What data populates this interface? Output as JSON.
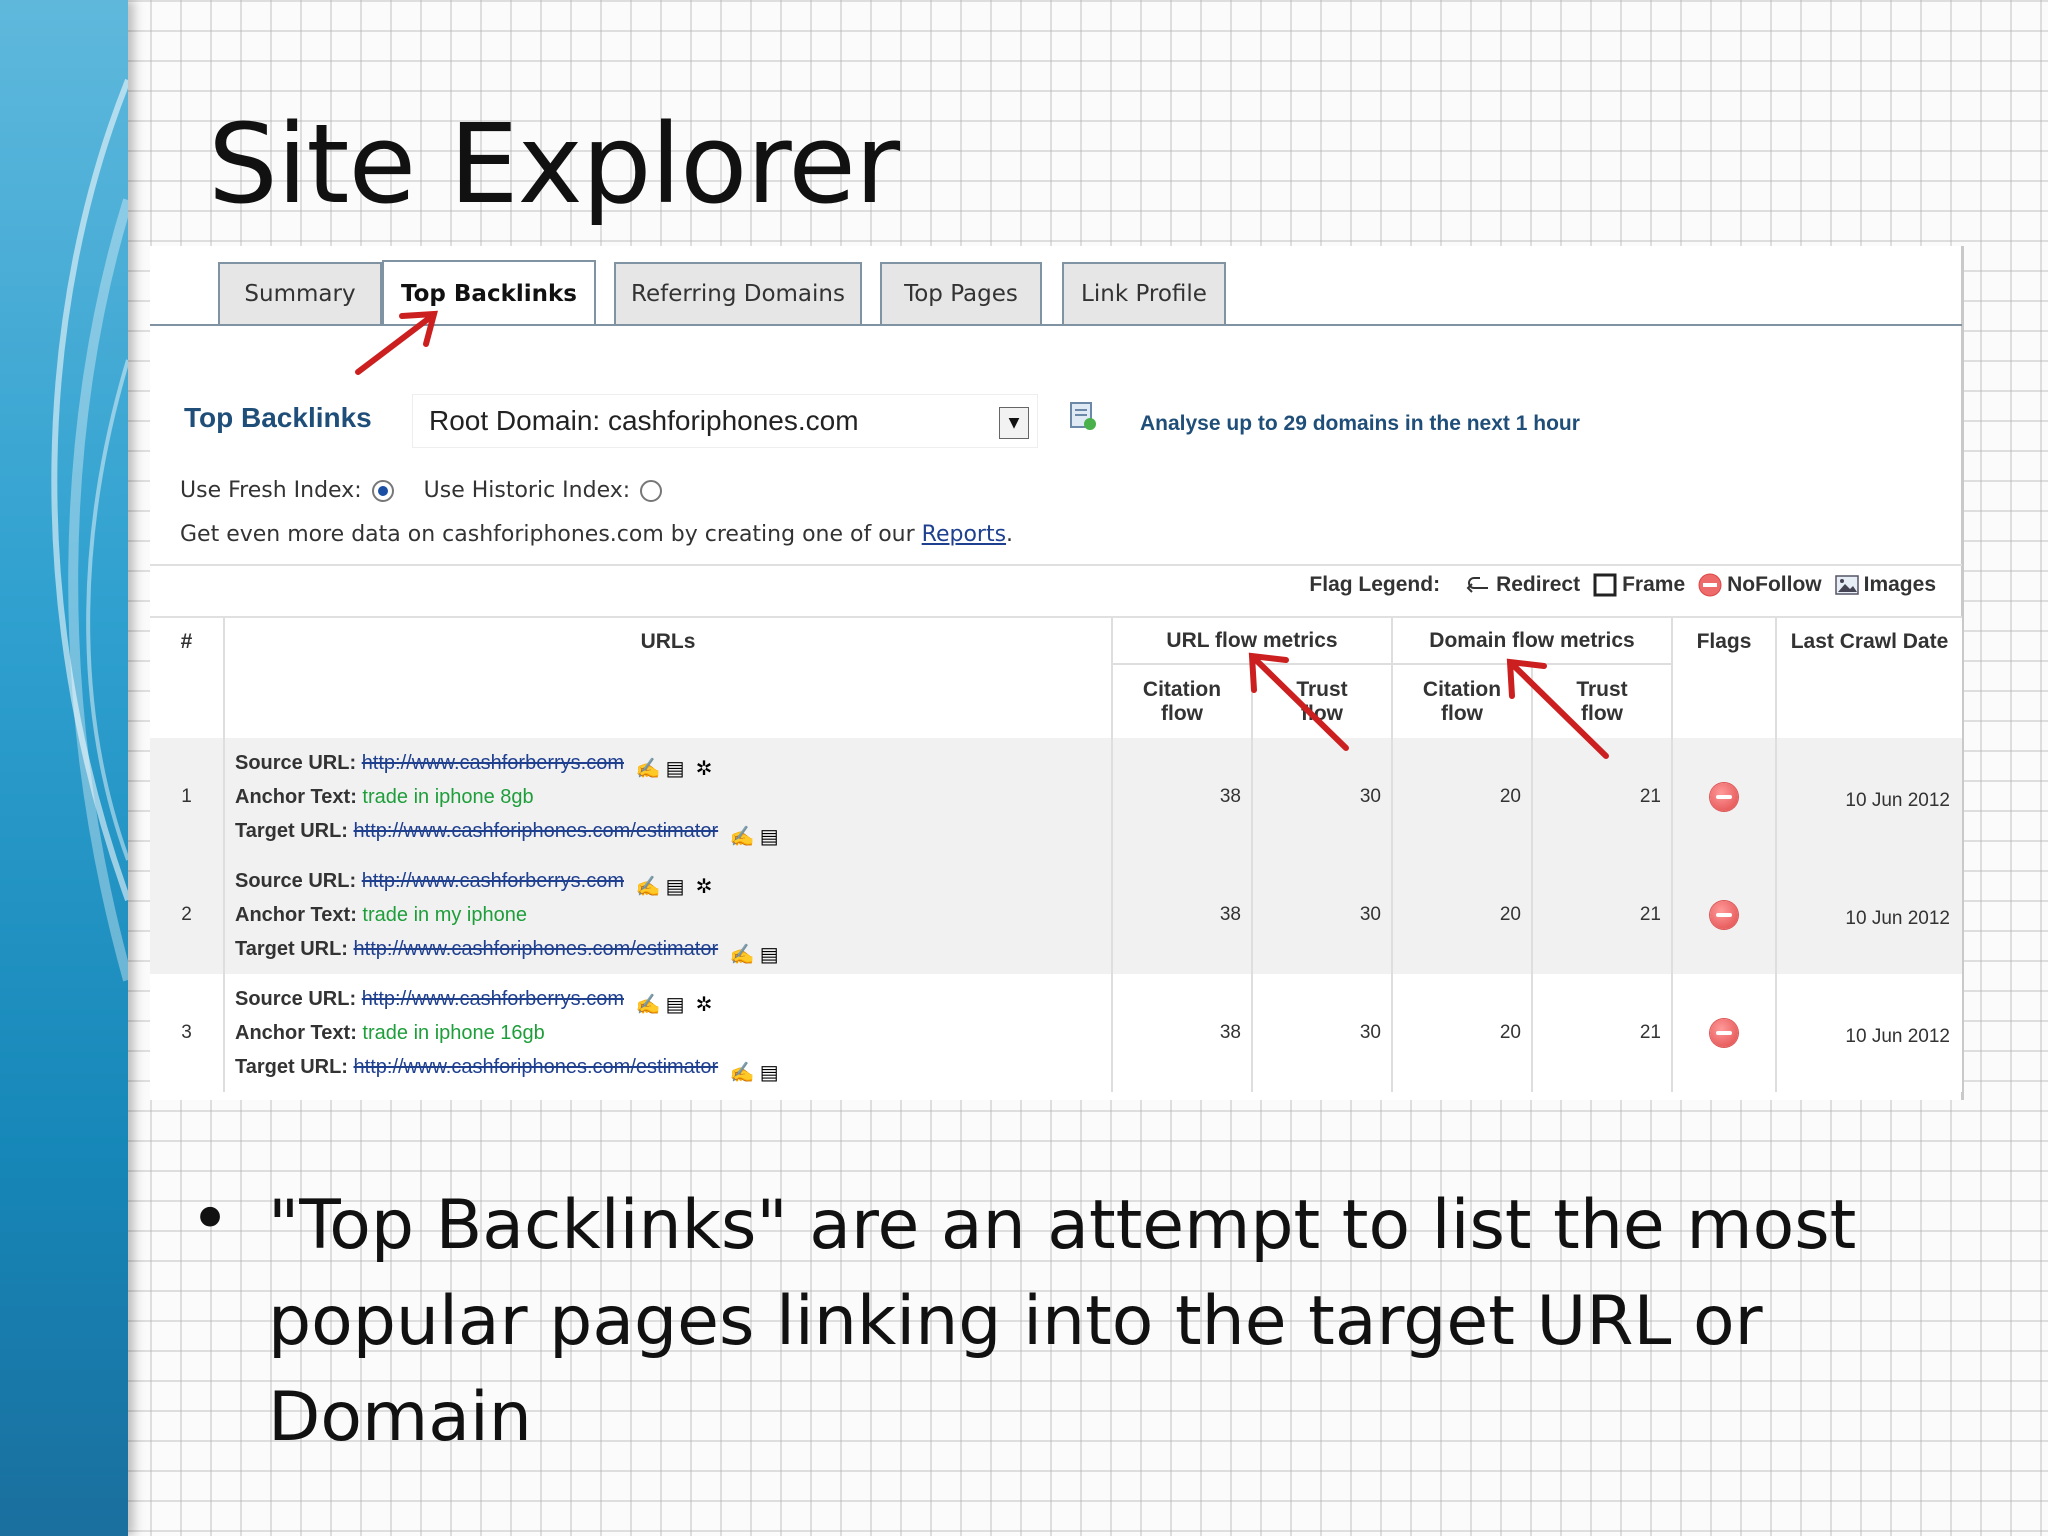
{
  "slide": {
    "title": "Site Explorer",
    "bullet": "\"Top Backlinks\" are an attempt to list the most popular pages linking into the target URL or Domain"
  },
  "tabs": [
    {
      "label": "Summary",
      "active": false
    },
    {
      "label": "Top Backlinks",
      "active": true
    },
    {
      "label": "Referring Domains",
      "active": false
    },
    {
      "label": "Top Pages",
      "active": false
    },
    {
      "label": "Link Profile",
      "active": false
    }
  ],
  "controls": {
    "section_label": "Top Backlinks",
    "domain_select": "Root Domain: cashforiphones.com",
    "analyse_text": "Analyse up to 29 domains in the next 1 hour",
    "fresh_index_label": "Use Fresh Index:",
    "fresh_index_selected": true,
    "historic_index_label": "Use Historic Index:",
    "historic_index_selected": false,
    "more_data_text": "Get even more data on cashforiphones.com by creating one of our",
    "reports_link": "Reports",
    "more_data_end": "."
  },
  "legend": {
    "title": "Flag Legend:",
    "items": [
      {
        "icon": "redirect-icon",
        "label": "Redirect"
      },
      {
        "icon": "frame-icon",
        "label": "Frame"
      },
      {
        "icon": "nofollow-icon",
        "label": "NoFollow"
      },
      {
        "icon": "images-icon",
        "label": "Images"
      }
    ]
  },
  "table": {
    "headers": {
      "num": "#",
      "urls": "URLs",
      "url_flow": "URL flow metrics",
      "domain_flow": "Domain flow metrics",
      "flags": "Flags",
      "last_crawl": "Last Crawl Date",
      "citation_flow": "Citation flow",
      "trust_flow": "Trust flow"
    },
    "labels": {
      "source": "Source URL:",
      "anchor": "Anchor Text:",
      "target": "Target URL:"
    },
    "rows": [
      {
        "num": "1",
        "source_url": "http://www.cashforberrys.com",
        "anchor_text": "trade in iphone 8gb",
        "target_url": "http://www.cashforiphones.com/estimator",
        "url_cf": "38",
        "url_tf": "30",
        "dom_cf": "20",
        "dom_tf": "21",
        "flag": "nofollow-icon",
        "date": "10 Jun 2012"
      },
      {
        "num": "2",
        "source_url": "http://www.cashforberrys.com",
        "anchor_text": "trade in my iphone",
        "target_url": "http://www.cashforiphones.com/estimator",
        "url_cf": "38",
        "url_tf": "30",
        "dom_cf": "20",
        "dom_tf": "21",
        "flag": "nofollow-icon",
        "date": "10 Jun 2012"
      },
      {
        "num": "3",
        "source_url": "http://www.cashforberrys.com",
        "anchor_text": "trade in iphone 16gb",
        "target_url": "http://www.cashforiphones.com/estimator",
        "url_cf": "38",
        "url_tf": "30",
        "dom_cf": "20",
        "dom_tf": "21",
        "flag": "nofollow-icon",
        "date": "10 Jun 2012"
      }
    ]
  },
  "colors": {
    "accent_arrow": "#cc1f1f",
    "heading_blue": "#1f4e79",
    "anchor_green": "#1e9e3a",
    "link_blue": "#1f3f8f"
  }
}
